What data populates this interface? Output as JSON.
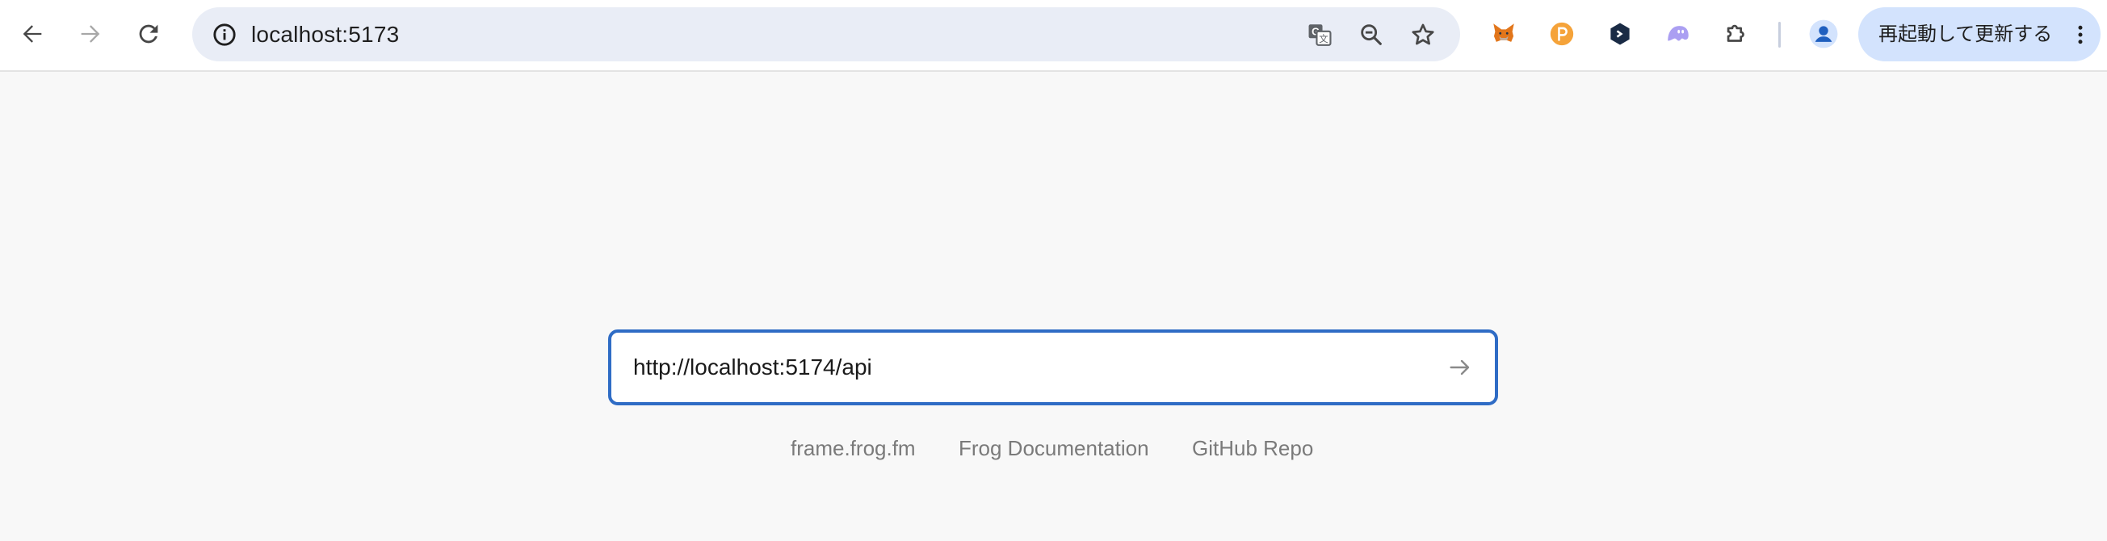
{
  "browser": {
    "url": "localhost:5173",
    "relaunch_label": "再起動して更新する",
    "nav": {
      "back_icon": "arrow-left-icon",
      "forward_icon": "arrow-right-icon",
      "reload_icon": "reload-icon"
    },
    "omnibox_icons": [
      "info-icon",
      "translate-icon",
      "zoom-out-icon",
      "bookmark-star-icon"
    ],
    "extensions": [
      "metamask-fox-icon",
      "orange-p-extension-icon",
      "dark-hexagon-extension-icon",
      "purple-ghost-extension-icon",
      "puzzle-extensions-icon"
    ],
    "profile_icon": "profile-avatar-icon",
    "menu_icon": "kebab-menu-icon"
  },
  "frame": {
    "input_value": "http://localhost:5174/api",
    "submit_icon": "arrow-right-icon"
  },
  "links": [
    {
      "label": "frame.frog.fm"
    },
    {
      "label": "Frog Documentation"
    },
    {
      "label": "GitHub Repo"
    }
  ],
  "colors": {
    "accent_border": "#2f6cc5",
    "relaunch_bg": "#d3e3fd",
    "omnibox_bg": "#e9edf6",
    "link_gray": "#7a7a7a"
  }
}
